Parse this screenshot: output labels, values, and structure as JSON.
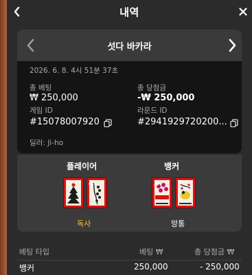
{
  "header": {
    "title": "내역"
  },
  "game": {
    "name": "섯다 바카라"
  },
  "details": {
    "datetime": "2026. 6. 8. 4시 51분 37초",
    "total_bet_label": "총 베팅",
    "total_bet_value": "₩ 250,000",
    "total_win_label": "총 당첨금",
    "total_win_value": "-₩ 250,000",
    "game_id_label": "게임 ID",
    "game_id_value": "#15078007920",
    "round_id_label": "라운드 ID",
    "round_id_value": "#2941929720200...",
    "dealer": "딜러: Ji-ho"
  },
  "player": {
    "title": "플레이어",
    "cards": [
      {
        "num": "1"
      },
      {
        "num": "4"
      }
    ],
    "hand_name": "독사"
  },
  "banker": {
    "title": "뱅커",
    "cards": [
      {
        "num": "3"
      },
      {
        "num": "7"
      }
    ],
    "hand_name": "망통"
  },
  "table": {
    "headers": [
      "베팅 타입",
      "베팅 ₩",
      "총 당첨금 ₩"
    ],
    "rows": [
      [
        "뱅커",
        "250,000",
        "- 250,000"
      ]
    ]
  },
  "colors": {
    "accent_gold": "#f2c23a",
    "card_red": "#d81414"
  },
  "icons": {
    "back": "chevron-left-icon",
    "close": "close-icon",
    "prev": "chevron-left-icon",
    "next": "chevron-right-icon",
    "copy": "copy-icon"
  }
}
